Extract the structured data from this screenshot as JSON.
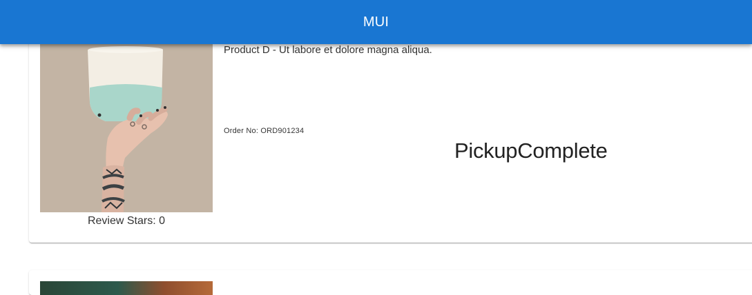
{
  "app_bar": {
    "title": "MUI",
    "background_color": "#1976d2",
    "text_color": "#ffffff"
  },
  "product_cards": [
    {
      "image": {
        "icon": "product-image",
        "description": "hand holding a white and mint ceramic cup"
      },
      "review_stars_text": "Review Stars: 0",
      "review_stars": 0,
      "description": "Product D - Ut labore et dolore magna aliqua.",
      "order_number": "Order No: ORD901234",
      "status": "PickupComplete"
    },
    {
      "image": {
        "icon": "product-image",
        "description": "partially visible product image"
      }
    }
  ]
}
